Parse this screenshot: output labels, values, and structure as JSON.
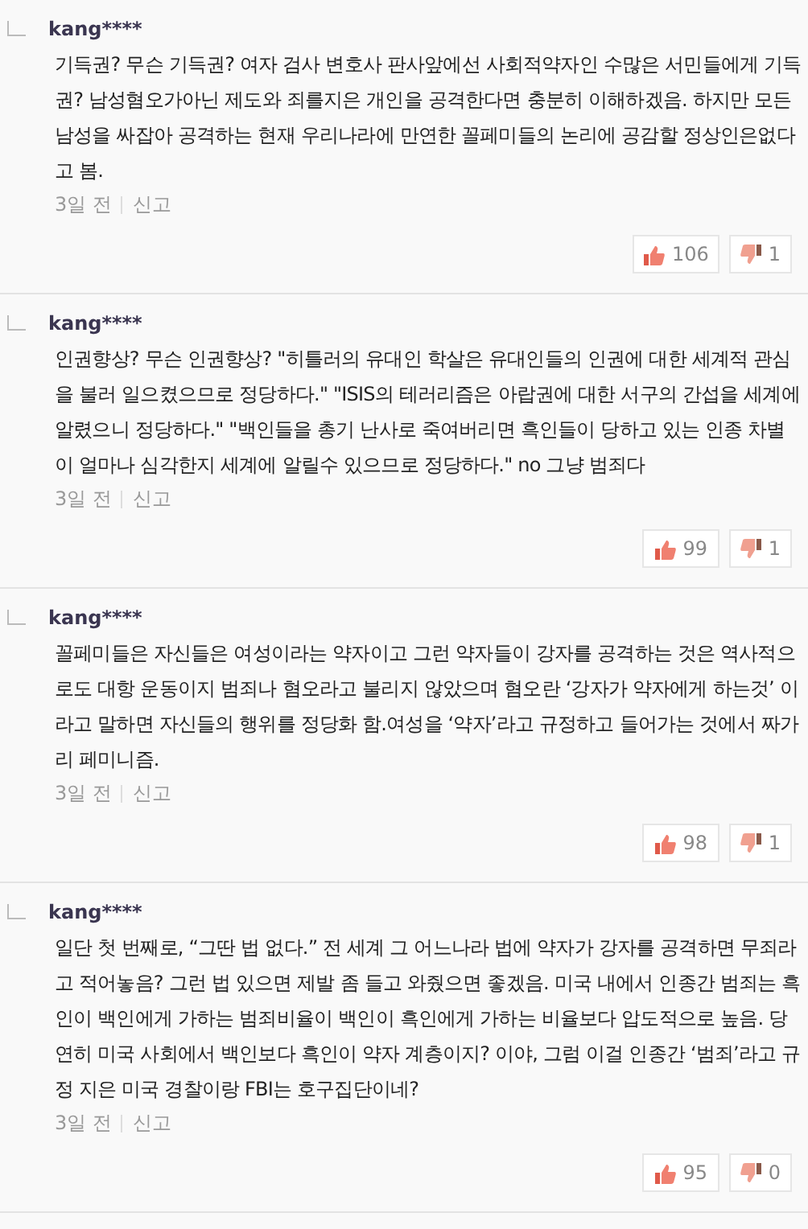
{
  "comments": [
    {
      "author": "kang****",
      "text": "기득권? 무슨 기득권? 여자 검사 변호사 판사앞에선 사회적약자인 수많은 서민들에게 기득권? 남성혐오가아닌 제도와 죄를지은 개인을 공격한다면 충분히 이해하겠음. 하지만 모든남성을 싸잡아 공격하는 현재 우리나라에 만연한 꼴페미들의 논리에 공감할 정상인은없다고 봄.",
      "time": "3일 전",
      "report": "신고",
      "likes": "106",
      "dislikes": "1"
    },
    {
      "author": "kang****",
      "text": "인권향상? 무슨 인권향상? \"히틀러의 유대인 학살은 유대인들의 인권에 대한 세계적 관심을 불러 일으켰으므로 정당하다.\" \"ISIS의 테러리즘은 아랍권에 대한 서구의 간섭을 세계에 알렸으니 정당하다.\" \"백인들을 총기 난사로 죽여버리면 흑인들이 당하고 있는 인종 차별이 얼마나 심각한지 세계에 알릴수 있으므로 정당하다.\" no 그냥 범죄다",
      "time": "3일 전",
      "report": "신고",
      "likes": "99",
      "dislikes": "1"
    },
    {
      "author": "kang****",
      "text": "꼴페미들은 자신들은 여성이라는 약자이고 그런 약자들이 강자를 공격하는 것은 역사적으로도 대항 운동이지 범죄나 혐오라고 불리지 않았으며 혐오란 ‘강자가 약자에게 하는것’ 이라고 말하면 자신들의 행위를 정당화 함.여성을 ‘약자’라고 규정하고 들어가는 것에서 짜가리 페미니즘.",
      "time": "3일 전",
      "report": "신고",
      "likes": "98",
      "dislikes": "1"
    },
    {
      "author": "kang****",
      "text": "일단 첫 번째로, “그딴 법 없다.” 전 세계 그 어느나라 법에 약자가 강자를 공격하면 무죄라고 적어놓음? 그런 법 있으면 제발 좀 들고 와줬으면 좋겠음. 미국 내에서 인종간 범죄는 흑인이 백인에게 가하는 범죄비율이 백인이 흑인에게 가하는 비율보다 압도적으로 높음. 당연히 미국 사회에서 백인보다 흑인이 약자 계층이지? 이야, 그럼 이걸 인종간 ‘범죄’라고 규정 지은 미국 경찰이랑 FBI는 호구집단이네?",
      "time": "3일 전",
      "report": "신고",
      "likes": "95",
      "dislikes": "0"
    }
  ]
}
